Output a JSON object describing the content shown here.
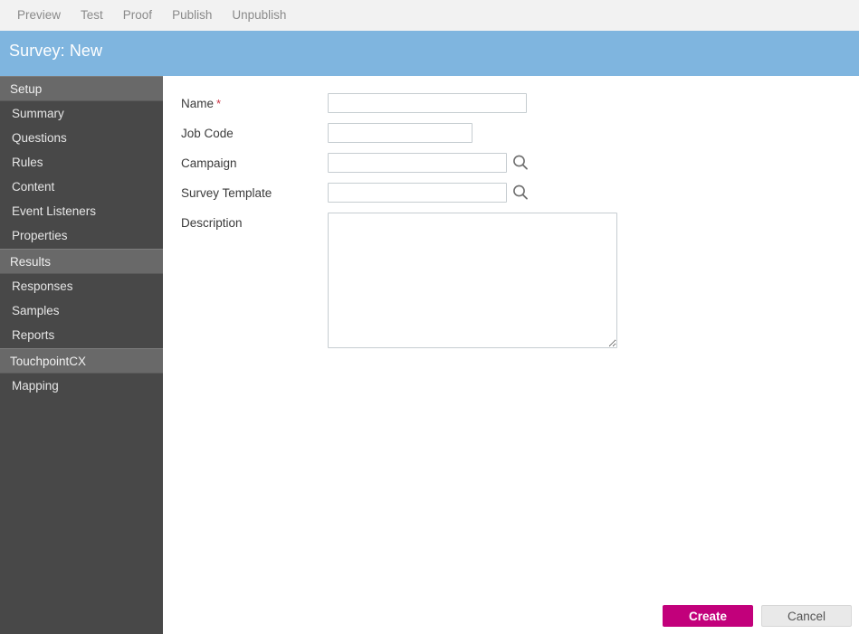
{
  "toolbar": {
    "items": [
      {
        "label": "Preview",
        "name": "preview"
      },
      {
        "label": "Test",
        "name": "test"
      },
      {
        "label": "Proof",
        "name": "proof"
      },
      {
        "label": "Publish",
        "name": "publish"
      },
      {
        "label": "Unpublish",
        "name": "unpublish"
      }
    ]
  },
  "header": {
    "title": "Survey: New",
    "background_color": "#7fb5df"
  },
  "sidebar": {
    "background_color": "#484848",
    "section_color": "#696969",
    "groups": [
      {
        "section": "Setup",
        "items": [
          {
            "label": "Summary"
          },
          {
            "label": "Questions"
          },
          {
            "label": "Rules"
          },
          {
            "label": "Content"
          },
          {
            "label": "Event Listeners"
          },
          {
            "label": "Properties"
          }
        ]
      },
      {
        "section": "Results",
        "items": [
          {
            "label": "Responses"
          },
          {
            "label": "Samples"
          },
          {
            "label": "Reports"
          }
        ]
      },
      {
        "section": "TouchpointCX",
        "items": [
          {
            "label": "Mapping"
          }
        ]
      }
    ]
  },
  "form": {
    "fields": {
      "name": {
        "label": "Name",
        "required": true,
        "value": "",
        "placeholder": ""
      },
      "job_code": {
        "label": "Job Code",
        "required": false,
        "value": "",
        "placeholder": ""
      },
      "campaign": {
        "label": "Campaign",
        "required": false,
        "value": "",
        "placeholder": "",
        "lookup_icon": "search-icon"
      },
      "survey_template": {
        "label": "Survey Template",
        "required": false,
        "value": "",
        "placeholder": "",
        "lookup_icon": "search-icon"
      },
      "description": {
        "label": "Description",
        "required": false,
        "value": "",
        "placeholder": ""
      }
    },
    "required_marker": "*"
  },
  "actions": {
    "create_label": "Create",
    "cancel_label": "Cancel",
    "create_color": "#c2007b",
    "cancel_color": "#e9e9e9"
  }
}
